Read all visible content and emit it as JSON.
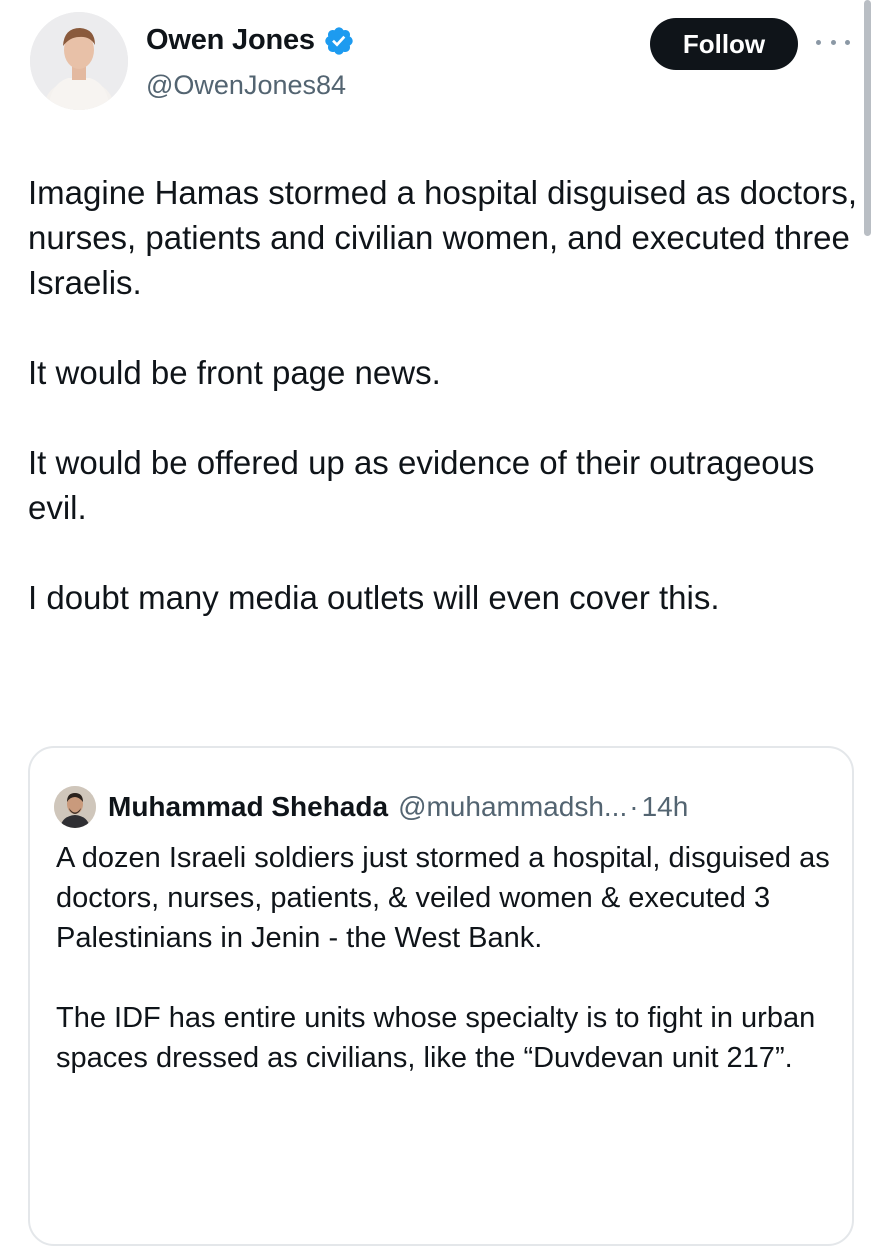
{
  "author": {
    "name": "Owen Jones",
    "handle": "@OwenJones84",
    "verified_icon": "verified-badge-icon",
    "verified_color": "#1d9bf0"
  },
  "actions": {
    "follow_label": "Follow",
    "more_icon": "more-options-icon"
  },
  "tweet": {
    "paragraphs": [
      "Imagine Hamas stormed a hospital disguised as doctors, nurses, patients and civilian women, and executed three Israelis.",
      "It would be front page news.",
      "It would be offered up as evidence of their outrageous evil.",
      "I doubt many media outlets will even cover this."
    ]
  },
  "quoted_tweet": {
    "name": "Muhammad Shehada",
    "handle": "@muhammadsh...",
    "separator": "·",
    "time": "14h",
    "paragraphs": [
      "A dozen Israeli soldiers just stormed a hospital, disguised as doctors, nurses, patients, & veiled women & executed 3 Palestinians in Jenin - the West Bank.",
      "The IDF has entire units whose specialty is to fight in urban spaces dressed as civilians, like the “Duvdevan unit 217”."
    ]
  },
  "colors": {
    "text_primary": "#0f1419",
    "text_secondary": "#536471",
    "follow_bg": "#0f1419",
    "card_border": "#e4e7ea"
  }
}
